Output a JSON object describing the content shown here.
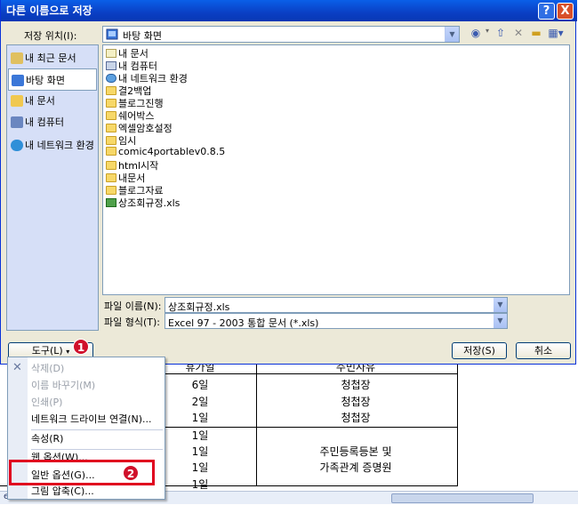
{
  "window": {
    "title": "다른 이름으로 저장",
    "help": "?",
    "close": "X"
  },
  "location": {
    "label": "저장 위치(I):",
    "value": "바탕 화면"
  },
  "places": [
    {
      "label": "내 최근 문서",
      "color": "#e0c060"
    },
    {
      "label": "바탕 화면",
      "color": "#3b77d8"
    },
    {
      "label": "내 문서",
      "color": "#f0c850"
    },
    {
      "label": "내 컴퓨터",
      "color": "#6a86c0"
    },
    {
      "label": "내 네트워크 환경",
      "color": "#2f8fd8"
    }
  ],
  "files": [
    {
      "name": "내 문서",
      "icon": "doc"
    },
    {
      "name": "내 컴퓨터",
      "icon": "pc"
    },
    {
      "name": "내 네트워크 환경",
      "icon": "net"
    },
    {
      "name": "결2백업",
      "icon": "folder"
    },
    {
      "name": "블로그진행",
      "icon": "folder"
    },
    {
      "name": "쉐어박스",
      "icon": "folder"
    },
    {
      "name": "엑셀암호설정",
      "icon": "folder"
    },
    {
      "name": "임시",
      "icon": "folder"
    },
    {
      "name": "comic4portablev0.8.5",
      "icon": "folder"
    },
    {
      "name": "html시작",
      "icon": "folder"
    },
    {
      "name": "내문서",
      "icon": "folder"
    },
    {
      "name": "블로그자료",
      "icon": "folder"
    },
    {
      "name": "상조회규정.xls",
      "icon": "xls"
    }
  ],
  "filename": {
    "label": "파일 이름(N):",
    "value": "상조회규정.xls"
  },
  "filetype": {
    "label": "파일 형식(T):",
    "value": "Excel 97 - 2003 통합 문서 (*.xls)"
  },
  "buttons": {
    "tools": "도구(L)",
    "save": "저장(S)",
    "cancel": "취소"
  },
  "badges": {
    "one": "1",
    "two": "2"
  },
  "menu": {
    "items": [
      {
        "label": "삭제(D)",
        "disabled": true
      },
      {
        "label": "이름 바꾸기(M)",
        "disabled": true
      },
      {
        "label": "인쇄(P)",
        "disabled": true
      },
      {
        "label": "네트워크 드라이브 연결(N)...",
        "disabled": false
      },
      {
        "label": "속성(R)",
        "disabled": false
      },
      {
        "label": "웹 옵션(W)...",
        "disabled": false
      },
      {
        "label": "일반 옵션(G)...",
        "disabled": false
      },
      {
        "label": "그림 압축(C)...",
        "disabled": false
      }
    ]
  },
  "sheet": {
    "header_col2": "휴가일",
    "header_col3": "주민사유",
    "rows": [
      {
        "days": "6일",
        "reason": "청첩장"
      },
      {
        "days": "2일",
        "reason": "청첩장"
      },
      {
        "days": "1일",
        "reason": "청첩장"
      },
      {
        "days": "1일",
        "reason": ""
      },
      {
        "days": "1일",
        "reason": "주민등록등본 및"
      },
      {
        "days": "1일",
        "reason": "가족관계 증명원"
      },
      {
        "days": "1일",
        "reason": ""
      }
    ],
    "tab_text": "eets"
  },
  "colors": {
    "title_bar": "#0a3fc4",
    "dialog_bg": "#ece9d8",
    "highlight": "#e0001e",
    "badge": "#d0102a"
  }
}
